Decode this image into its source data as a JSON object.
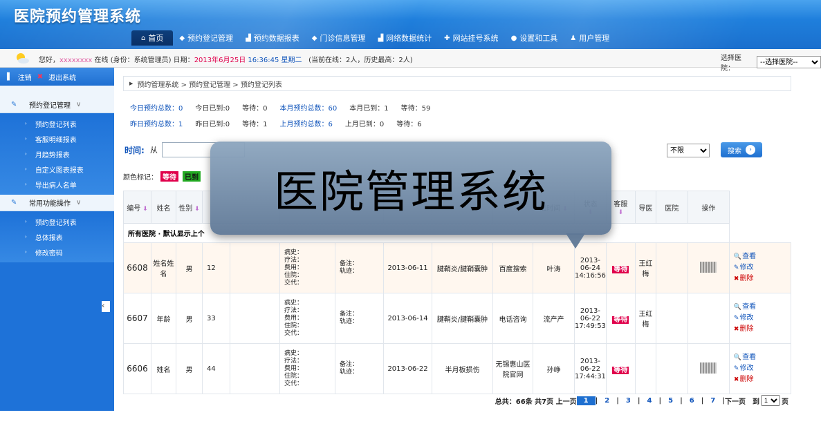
{
  "header": {
    "title": "医院预约管理系统",
    "nav": [
      {
        "label": "首页",
        "icon": "home-icon",
        "active": true
      },
      {
        "label": "预约登记管理",
        "icon": "arrow-icon"
      },
      {
        "label": "预约数据报表",
        "icon": "bar-chart-icon"
      },
      {
        "label": "门诊信息管理",
        "icon": "arrow-icon"
      },
      {
        "label": "网络数据统计",
        "icon": "bar-chart-icon"
      },
      {
        "label": "网站挂号系统",
        "icon": "plus-icon"
      },
      {
        "label": "设置和工具",
        "icon": "gear-icon"
      },
      {
        "label": "用户管理",
        "icon": "user-icon"
      }
    ]
  },
  "infobar": {
    "greeting": "您好，",
    "online_suffix": " 在线 (身份：系统管理员)  日期：",
    "time": " 16:36:45 星期二",
    "stats": "(当前在线：2人，历史最高：2人)",
    "hospital_label": "选择医院：",
    "hospital_value": "--选择医院--"
  },
  "sidebar": {
    "logout": "注销",
    "exit": "退出系统",
    "groups": [
      {
        "title": "预约登记管理",
        "items": [
          "预约登记列表",
          "客服明细报表",
          "月趋势报表",
          "自定义图表报表",
          "导出病人名单"
        ]
      },
      {
        "title": "常用功能操作",
        "items": [
          "预约登记列表",
          "总体报表",
          "修改密码"
        ]
      }
    ]
  },
  "breadcrumb": "预约管理系统 > 预约登记管理 > 预约登记列表",
  "stats": {
    "today_total_label": "今日预约总数：0",
    "today_arrived": "今日已到:0",
    "today_wait": "等待：0",
    "month_total_label": "本月预约总数：60",
    "month_arrived": "本月已到：1",
    "month_wait": "等待：59",
    "yest_total_label": "昨日预约总数：1",
    "yest_arrived": "昨日已到:0",
    "yest_wait": "等待：1",
    "lastmonth_total_label": "上月预约总数：6",
    "lastmonth_arrived": "上月已到：0",
    "lastmonth_wait": "等待：6"
  },
  "search": {
    "time_label": "时间:",
    "from_label": "从",
    "status_value": "不限",
    "button": "搜索"
  },
  "legend": {
    "label": "颜色标记：",
    "wait": "等待",
    "arrived": "已到"
  },
  "table": {
    "headers": [
      "编号",
      "姓名",
      "性别",
      "",
      "",
      "",
      "",
      "",
      "",
      "",
      "加时间",
      "状态",
      "客服",
      "导医",
      "医院",
      "操作"
    ],
    "group_label": "所有医院 · 默认显示上个",
    "rows": [
      {
        "id": "6608",
        "name": "姓名姓名",
        "sex": "男",
        "age": "12",
        "info": "病史：\n疗法：\n费用：\n住院：\n交代：",
        "note": "备注：\n轨迹：",
        "date": "2013-06-11",
        "disease": "腱鞘炎/腱鞘囊肿",
        "source": "百度搜索",
        "staff": "叶涛",
        "added": "2013-06-24 14:16:56",
        "status": "等待",
        "cs": "王红梅"
      },
      {
        "id": "6607",
        "name": "年龄",
        "sex": "男",
        "age": "33",
        "info": "病史：\n疗法：\n费用：\n住院：\n交代：",
        "note": "备注：\n轨迹：",
        "date": "2013-06-14",
        "disease": "腱鞘炎/腱鞘囊肿",
        "source": "电话咨询",
        "staff": "流产产",
        "added": "2013-06-22 17:49:53",
        "status": "等待",
        "cs": "王红梅"
      },
      {
        "id": "6606",
        "name": "姓名",
        "sex": "男",
        "age": "44",
        "info": "病史：\n疗法：\n费用：\n住院：\n交代：",
        "note": "备注：\n轨迹：",
        "date": "2013-06-22",
        "disease": "半月板损伤",
        "source": "无锡惠山医院官网",
        "staff": "孙峥",
        "added": "2013-06-22 17:44:31",
        "status": "等待",
        "cs": ""
      }
    ],
    "ops": {
      "view": "查看",
      "edit": "修改",
      "delete": "删除"
    }
  },
  "pager": {
    "summary": "总共：66条  共7页  上一页",
    "pages": [
      "1",
      "2",
      "3",
      "4",
      "5",
      "6",
      "7"
    ],
    "next": "下一页",
    "goto": "到",
    "goto_value": "1",
    "page_suffix": "页"
  },
  "overlay": {
    "text": "医院管理系统"
  }
}
